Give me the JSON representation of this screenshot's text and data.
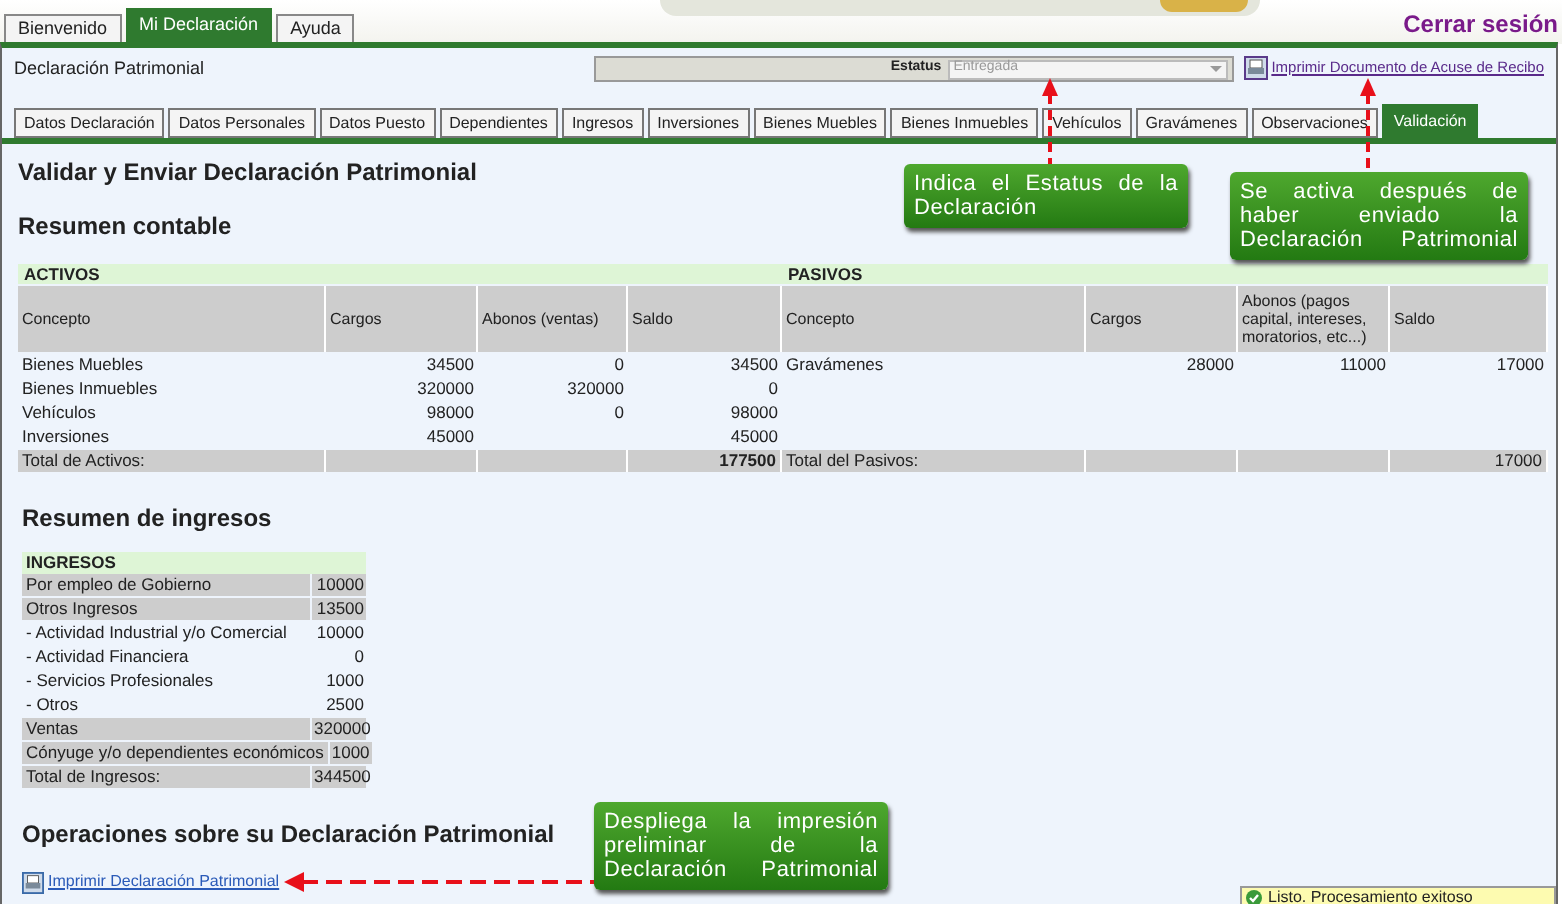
{
  "top_tabs": [
    {
      "label": "Bienvenido",
      "selected": false
    },
    {
      "label": "Mi Declaración",
      "selected": true
    },
    {
      "label": "Ayuda",
      "selected": false
    }
  ],
  "logout": "Cerrar sesión",
  "header": {
    "title": "Declaración Patrimonial",
    "status_label": "Estatus",
    "status_value": "Entregada",
    "status_disabled": true,
    "print_receipt_link": "Imprimir Documento de Acuse de Recibo"
  },
  "tabs": [
    {
      "label": "Datos Declaración",
      "selected": false
    },
    {
      "label": "Datos Personales",
      "selected": false
    },
    {
      "label": "Datos Puesto",
      "selected": false
    },
    {
      "label": "Dependientes",
      "selected": false
    },
    {
      "label": "Ingresos",
      "selected": false
    },
    {
      "label": "Inversiones",
      "selected": false
    },
    {
      "label": "Bienes Muebles",
      "selected": false
    },
    {
      "label": "Bienes Inmuebles",
      "selected": false
    },
    {
      "label": "Vehículos",
      "selected": false
    },
    {
      "label": "Gravámenes",
      "selected": false
    },
    {
      "label": "Observaciones",
      "selected": false
    },
    {
      "label": "Validación",
      "selected": true
    }
  ],
  "page_title": "Validar y Enviar Declaración Patrimonial",
  "accounting_title": "Resumen contable",
  "accounting_tables": [
    {
      "title": "ACTIVOS",
      "columns": [
        "Concepto",
        "Cargos",
        "Abonos (ventas)",
        "Saldo"
      ],
      "rows": [
        [
          "Bienes Muebles",
          "34500",
          "0",
          "34500"
        ],
        [
          "Bienes Inmuebles",
          "320000",
          "320000",
          "0"
        ],
        [
          "Vehículos",
          "98000",
          "0",
          "98000"
        ],
        [
          "Inversiones",
          "45000",
          null,
          "45000"
        ]
      ],
      "total": {
        "label": "Total de Activos:",
        "value": "177500"
      }
    },
    {
      "title": "PASIVOS",
      "columns": [
        "Concepto",
        "Cargos",
        "Abonos (pagos capital, intereses, moratorios, etc...)",
        "Saldo"
      ],
      "rows": [
        [
          "Gravámenes",
          "28000",
          "11000",
          "17000"
        ]
      ],
      "total": {
        "label": "Total del Pasivos:",
        "value": "17000"
      }
    }
  ],
  "income_title": "Resumen de ingresos",
  "income_table": {
    "title": "INGRESOS",
    "rows": [
      {
        "kind": "main",
        "label": "Por empleo de Gobierno",
        "value": "10000"
      },
      {
        "kind": "main",
        "label": "Otros Ingresos",
        "value": "13500"
      },
      {
        "kind": "sub",
        "label": "- Actividad Industrial y/o Comercial",
        "value": "10000"
      },
      {
        "kind": "sub",
        "label": "- Actividad Financiera",
        "value": "0"
      },
      {
        "kind": "sub",
        "label": "- Servicios Profesionales",
        "value": "1000"
      },
      {
        "kind": "sub",
        "label": "- Otros",
        "value": "2500"
      },
      {
        "kind": "main",
        "label": "Ventas",
        "value": "320000"
      },
      {
        "kind": "main",
        "label": "Cónyuge y/o dependientes económicos",
        "value": "1000"
      },
      {
        "kind": "main",
        "label": "Total de Ingresos:",
        "value": "344500"
      }
    ]
  },
  "operations_title": "Operaciones sobre su Declaración Patrimonial",
  "print_link": "Imprimir Declaración Patrimonial",
  "callouts": [
    {
      "text": "Indica el Estatus de la Declaración"
    },
    {
      "text": "Se activa después de haber enviado la Declaración Patrimonial"
    },
    {
      "text": "Despliega la impresión preliminar de la Declaración Patrimonial"
    }
  ],
  "toast": "Listo. Procesamiento exitoso"
}
